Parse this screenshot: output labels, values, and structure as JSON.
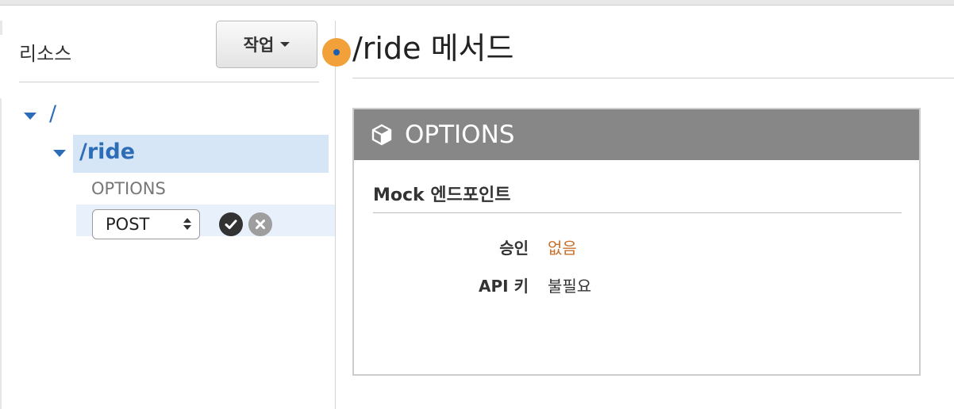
{
  "left_panel": {
    "title": "리소스",
    "actions_button": "작업"
  },
  "tree": {
    "root": "/",
    "child": "/ride",
    "method_item": "OPTIONS",
    "new_method_select": {
      "selected": "POST"
    }
  },
  "main": {
    "title": "/ride 메서드",
    "method_box": {
      "title": "OPTIONS",
      "section_title": "Mock 엔드포인트",
      "fields": [
        {
          "key": "승인",
          "value": "없음"
        },
        {
          "key": "API 키",
          "value": "불필요"
        }
      ]
    }
  },
  "colors": {
    "link_blue": "#2d6db7",
    "selected_row": "#d6e6f7",
    "box_header": "#878787",
    "warning_orange": "#c8702a",
    "status_dot": "#f1a03a"
  },
  "icons": {
    "tree_caret": "triangle-down",
    "confirm": "checkmark-circle",
    "cancel": "x-circle",
    "box": "cube"
  }
}
